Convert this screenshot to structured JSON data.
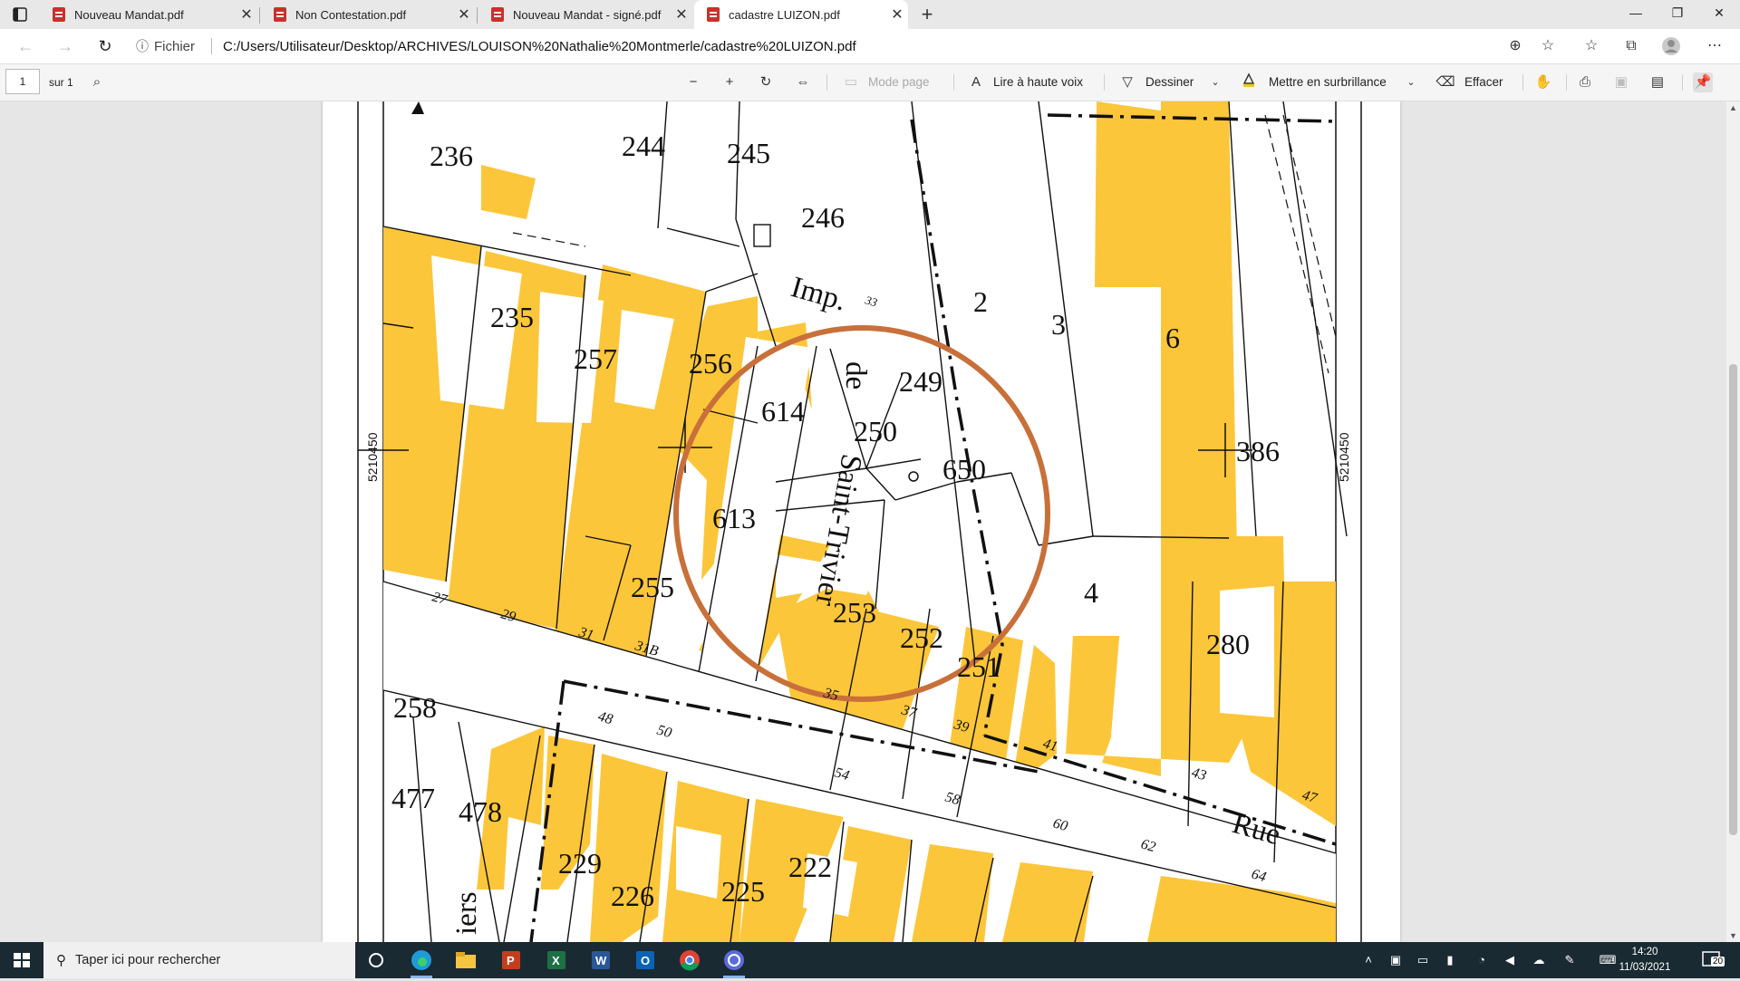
{
  "browser": {
    "tabs": [
      {
        "title": "Nouveau Mandat.pdf",
        "active": false
      },
      {
        "title": "Non Contestation.pdf",
        "active": false
      },
      {
        "title": "Nouveau Mandat - signé.pdf",
        "active": false
      },
      {
        "title": "cadastre LUIZON.pdf",
        "active": true
      }
    ],
    "new_tab_label": "+",
    "address": {
      "scheme_label": "Fichier",
      "url": "C:/Users/Utilisateur/Desktop/ARCHIVES/LOUISON%20Nathalie%20Montmerle/cadastre%20LUIZON.pdf"
    }
  },
  "pdf_toolbar": {
    "page_number": "1",
    "page_total": "sur 1",
    "page_view_label": "Mode page",
    "read_aloud_label": "Lire à haute voix",
    "draw_label": "Dessiner",
    "highlight_label": "Mettre en surbrillance",
    "erase_label": "Effacer",
    "highlight_color": "#f2c71e"
  },
  "map": {
    "parcel_color": "#fcc63a",
    "circle_color": "#c8703a",
    "coordinate_left": "5210450",
    "coordinate_right": "5210450",
    "parcels": [
      "236",
      "244",
      "245",
      "246",
      "235",
      "257",
      "256",
      "614",
      "249",
      "250",
      "650",
      "613",
      "255",
      "253",
      "252",
      "251",
      "2",
      "3",
      "6",
      "386",
      "4",
      "280",
      "258",
      "477",
      "478",
      "229",
      "226",
      "225",
      "222"
    ],
    "street_numbers": [
      "27",
      "29",
      "31",
      "31B",
      "33",
      "35",
      "37",
      "39",
      "41",
      "43",
      "47",
      "48",
      "50",
      "54",
      "58",
      "60",
      "62",
      "64"
    ],
    "street_names": [
      "Imp.",
      "de",
      "Saint-Trivier",
      "Rue",
      "iers"
    ]
  },
  "taskbar": {
    "search_placeholder": "Taper ici pour rechercher",
    "time": "14:20",
    "date": "11/03/2021",
    "notification_count": "20"
  }
}
